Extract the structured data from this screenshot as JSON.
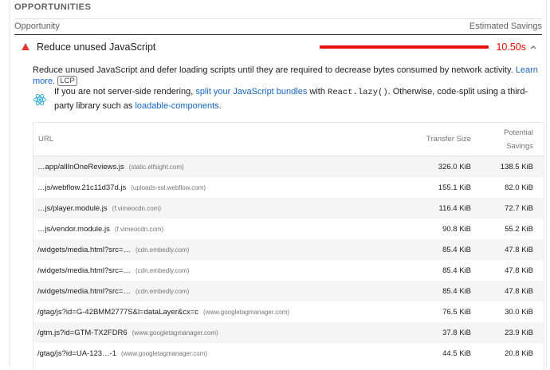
{
  "section": {
    "title": "Opportunities"
  },
  "columns": {
    "opportunity": "Opportunity",
    "savings": "Estimated Savings"
  },
  "audit": {
    "title": "Reduce unused JavaScript",
    "savings": "10.50s",
    "status_color": "#eb0f00",
    "expanded": true
  },
  "description": {
    "text": "Reduce unused JavaScript and defer loading scripts until they are required to decrease bytes consumed by network activity.",
    "learn_more": "Learn more.",
    "badge": "LCP"
  },
  "stack_pack": {
    "icon": "react-icon",
    "text_before": "If you are not server-side rendering, ",
    "link1": "split your JavaScript bundles",
    "text_mid": " with ",
    "code": "React.lazy()",
    "text_after": ". Otherwise, code-split using a third-party library such as ",
    "link2": "loadable-components",
    "text_end": "."
  },
  "table": {
    "headers": {
      "url": "URL",
      "transfer": "Transfer Size",
      "potential_1": "Potential",
      "potential_2": "Savings"
    },
    "rows": [
      {
        "url": "…app/allInOneReviews.js",
        "host": "(static.elfsight.com)",
        "transfer": "326.0 KiB",
        "savings": "138.5 KiB"
      },
      {
        "url": "…js/webflow.21c11d37d.js",
        "host": "(uploads-ssl.webflow.com)",
        "transfer": "155.1 KiB",
        "savings": "82.0 KiB"
      },
      {
        "url": "…js/player.module.js",
        "host": "(f.vimeocdn.com)",
        "transfer": "116.4 KiB",
        "savings": "72.7 KiB"
      },
      {
        "url": "…js/vendor.module.js",
        "host": "(f.vimeocdn.com)",
        "transfer": "90.8 KiB",
        "savings": "55.2 KiB"
      },
      {
        "url": "/widgets/media.html?src=…",
        "host": "(cdn.embedly.com)",
        "transfer": "85.4 KiB",
        "savings": "47.8 KiB"
      },
      {
        "url": "/widgets/media.html?src=…",
        "host": "(cdn.embedly.com)",
        "transfer": "85.4 KiB",
        "savings": "47.8 KiB"
      },
      {
        "url": "/widgets/media.html?src=…",
        "host": "(cdn.embedly.com)",
        "transfer": "85.4 KiB",
        "savings": "47.8 KiB"
      },
      {
        "url": "/gtag/js?id=G-42BMM2777S&l=dataLayer&cx=c",
        "host": "(www.googletagmanager.com)",
        "transfer": "76.5 KiB",
        "savings": "30.0 KiB"
      },
      {
        "url": "/gtm.js?id=GTM-TX2FDR6",
        "host": "(www.googletagmanager.com)",
        "transfer": "37.8 KiB",
        "savings": "23.9 KiB"
      },
      {
        "url": "/gtag/js?id=UA-123…-1",
        "host": "(www.googletagmanager.com)",
        "transfer": "44.5 KiB",
        "savings": "20.8 KiB"
      }
    ]
  }
}
